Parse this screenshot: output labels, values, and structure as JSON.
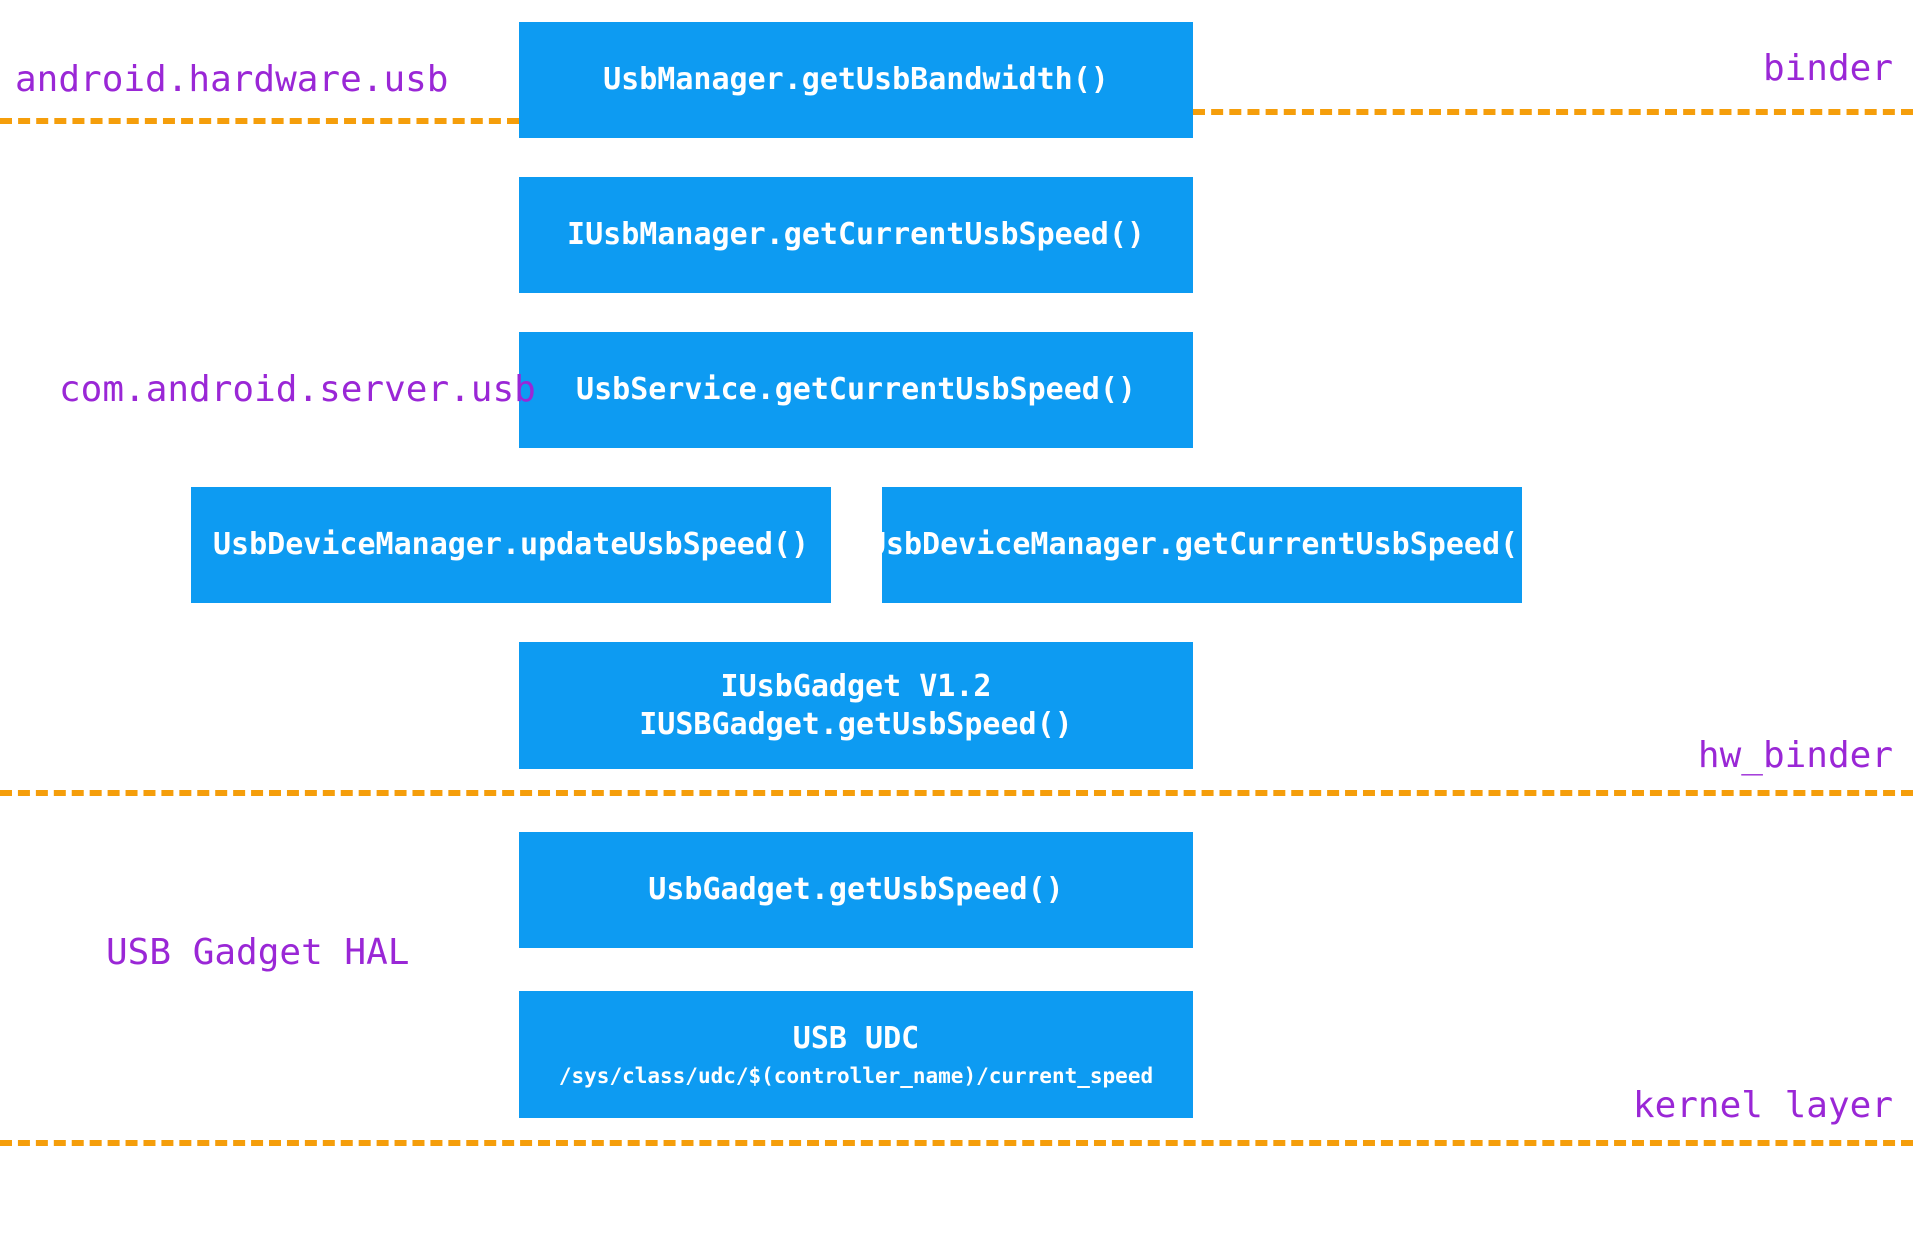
{
  "boxes": {
    "b1": "UsbManager.getUsbBandwidth()",
    "b2": "IUsbManager.getCurrentUsbSpeed()",
    "b3": "UsbService.getCurrentUsbSpeed()",
    "b4a": "UsbDeviceManager.updateUsbSpeed()",
    "b4b": "UsbDeviceManager.getCurrentUsbSpeed()",
    "b5_line1": "IUsbGadget V1.2",
    "b5_line2": "IUSBGadget.getUsbSpeed()",
    "b6": "UsbGadget.getUsbSpeed()",
    "b7_line1": "USB UDC",
    "b7_line2": "/sys/class/udc/$(controller_name)/current_speed"
  },
  "labels": {
    "l_top_left": "android.hardware.usb",
    "l_top_right": "binder",
    "l_mid_left": "com.android.server.usb",
    "l_hw_right": "hw_binder",
    "l_hal_left": "USB Gadget HAL",
    "l_kernel_right": "kernel layer"
  }
}
